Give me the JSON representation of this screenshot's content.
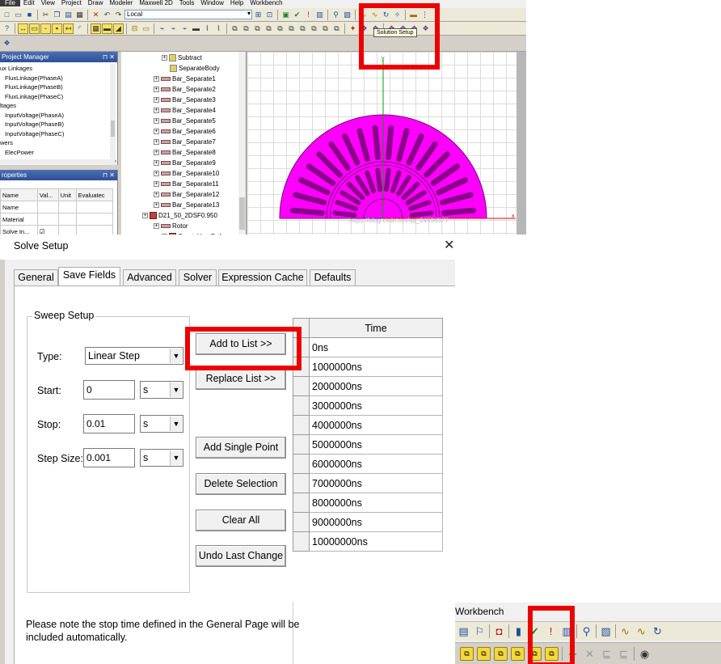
{
  "app": {
    "menu": [
      "File",
      "Edit",
      "View",
      "Project",
      "Draw",
      "Modeler",
      "Maxwell 2D",
      "Tools",
      "Window",
      "Help",
      "Workbench"
    ],
    "coordinate_system": "Local",
    "tooltip": "Solution Setup",
    "project_manager": {
      "title": "Project Manager",
      "items": [
        {
          "text": "ux Linkages",
          "level": 0
        },
        {
          "text": "FluxLinkage(PhaseA)",
          "level": 1
        },
        {
          "text": "FluxLinkage(PhaseB)",
          "level": 1
        },
        {
          "text": "FluxLinkage(PhaseC)",
          "level": 1
        },
        {
          "text": "ltages",
          "level": 0
        },
        {
          "text": "InputVoltage(PhaseA)",
          "level": 1
        },
        {
          "text": "InputVoltage(PhaseB)",
          "level": 1
        },
        {
          "text": "InputVoltage(PhaseC)",
          "level": 1
        },
        {
          "text": "wers",
          "level": 0
        },
        {
          "text": "ElecPower",
          "level": 1
        }
      ]
    },
    "properties": {
      "title": "roperties",
      "columns": [
        "Name",
        "Val...",
        "Unit",
        "Evaluatec"
      ],
      "rows": [
        "Name",
        "Material",
        "Solve In..."
      ]
    },
    "tree": {
      "items": [
        "Subtract",
        "SeparateBody",
        "Bar_Separate1",
        "Bar_Separate2",
        "Bar_Separate3",
        "Bar_Separate4",
        "Bar_Separate5",
        "Bar_Separate6",
        "Bar_Separate7",
        "Bar_Separate8",
        "Bar_Separate9",
        "Bar_Separate10",
        "Bar_Separate11",
        "Bar_Separate12",
        "Bar_Separate13",
        "D21_50_2DSF0.950",
        "Rotor",
        "CreateUserDef"
      ]
    },
    "viewport": {
      "y_axis_label": "y",
      "x_axis_label": "x",
      "watermark": "https://blog.csdn.net/qq_24598377",
      "geometry_color": "#ff00ff"
    }
  },
  "dialog": {
    "title": "Solve Setup",
    "close_glyph": "✕",
    "tabs": [
      "General",
      "Save Fields",
      "Advanced",
      "Solver",
      "Expression Cache",
      "Defaults"
    ],
    "active_tab": "Save Fields",
    "sweep": {
      "legend": "Sweep Setup",
      "type_label": "Type:",
      "type_value": "Linear Step",
      "start_label": "Start:",
      "start_value": "0",
      "start_unit": "s",
      "stop_label": "Stop:",
      "stop_value": "0.01",
      "stop_unit": "s",
      "step_label": "Step Size:",
      "step_value": "0.001",
      "step_unit": "s"
    },
    "buttons": {
      "add_to_list": "Add to List >>",
      "replace_list": "Replace List >>",
      "add_single_point": "Add Single Point",
      "delete_selection": "Delete Selection",
      "clear_all": "Clear All",
      "undo_last_change": "Undo Last Change"
    },
    "time_table": {
      "header": "Time",
      "values": [
        "0ns",
        "1000000ns",
        "2000000ns",
        "3000000ns",
        "4000000ns",
        "5000000ns",
        "6000000ns",
        "7000000ns",
        "8000000ns",
        "9000000ns",
        "10000000ns"
      ]
    },
    "note": "Please note the stop time defined in the General Page will be included automatically."
  },
  "workbench": {
    "title": "Workbench"
  },
  "highlight_color": "#ee0000"
}
